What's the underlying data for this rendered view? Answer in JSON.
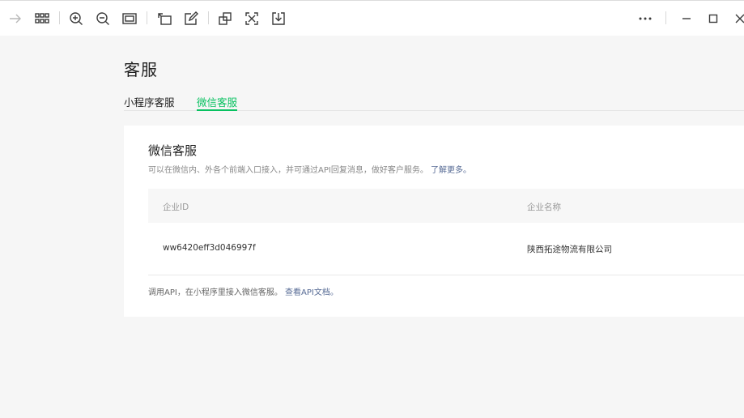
{
  "toolbar": {
    "icons": [
      "forward-arrow-icon",
      "grid-view-icon",
      "zoom-in-icon",
      "zoom-out-icon",
      "fit-screen-icon",
      "rotate-icon",
      "edit-icon",
      "copy-to-icon",
      "fullscreen-icon",
      "download-icon",
      "more-icon",
      "minimize-icon",
      "maximize-icon",
      "close-icon"
    ]
  },
  "page": {
    "title": "客服",
    "tabs": [
      {
        "label": "小程序客服",
        "active": false
      },
      {
        "label": "微信客服",
        "active": true
      }
    ]
  },
  "card": {
    "title": "微信客服",
    "desc": "可以在微信内、外各个前端入口接入，并可通过API回复消息，做好客户服务。",
    "desc_link": "了解更多。",
    "columns": [
      "企业ID",
      "企业名称"
    ],
    "rows": [
      {
        "id": "ww6420eff3d046997f",
        "name": "陕西拓途物流有限公司"
      }
    ],
    "footer": "调用API，在小程序里接入微信客服。",
    "footer_link": "查看API文档。"
  },
  "colors": {
    "accent": "#07c160",
    "link": "#576b95",
    "background": "#f6f6f6"
  }
}
